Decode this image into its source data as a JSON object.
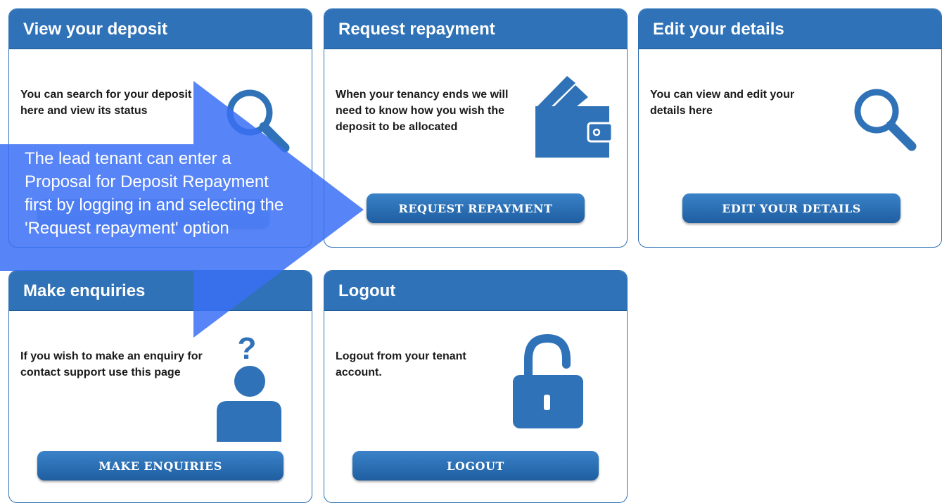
{
  "cards": {
    "view_deposit": {
      "title": "View your deposit",
      "text": "You can search for your deposit here and view its status",
      "icon": "search-icon"
    },
    "request_repayment": {
      "title": "Request repayment",
      "text": "When your tenancy ends we will need to know how you wish the deposit to be allocated",
      "button": "REQUEST REPAYMENT",
      "icon": "wallet-icon"
    },
    "edit_details": {
      "title": "Edit your details",
      "text": "You can view and edit your details here",
      "button": "EDIT YOUR DETAILS",
      "icon": "search-icon"
    },
    "make_enquiries": {
      "title": "Make enquiries",
      "text": "If you wish to make an enquiry for contact support use this page",
      "button": "MAKE ENQUIRIES",
      "icon": "question-person-icon"
    },
    "logout": {
      "title": "Logout",
      "text": "Logout from your tenant account.",
      "button": "LOGOUT",
      "icon": "unlock-icon"
    }
  },
  "callout": {
    "text": "The lead tenant can enter a Proposal for Deposit Repayment first by logging in and selecting the 'Request repayment' option"
  },
  "colors": {
    "accent": "#2f72b7",
    "button": "#1f5ea1",
    "callout": "#3a6ff5"
  }
}
